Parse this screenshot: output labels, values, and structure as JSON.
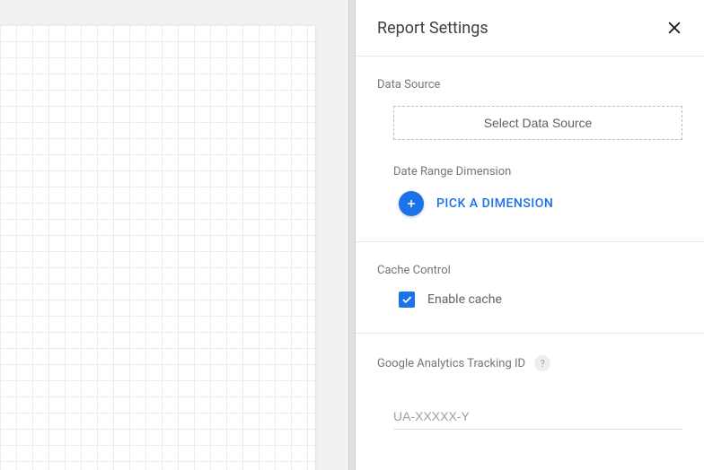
{
  "panel": {
    "title": "Report Settings"
  },
  "dataSource": {
    "label": "Data Source",
    "button": "Select Data Source",
    "dateRangeLabel": "Date Range Dimension",
    "pickDimension": "PICK A DIMENSION"
  },
  "cache": {
    "label": "Cache Control",
    "enable": "Enable cache",
    "checked": true
  },
  "tracking": {
    "label": "Google Analytics Tracking ID",
    "help": "?",
    "placeholder": "UA-XXXXX-Y",
    "value": ""
  }
}
